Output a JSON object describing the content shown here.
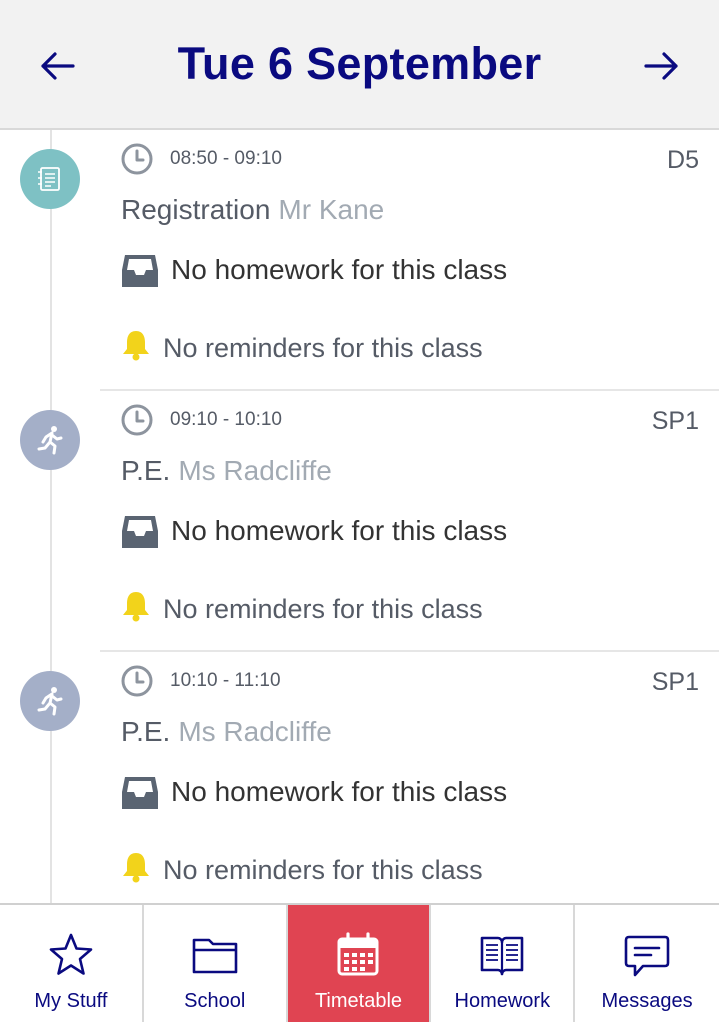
{
  "header": {
    "title": "Tue 6 September",
    "prev_icon": "arrow-left-icon",
    "next_icon": "arrow-right-icon",
    "accent_color": "#0a0a80"
  },
  "lessons": [
    {
      "time": "08:50 - 09:10",
      "room": "D5",
      "subject": "Registration",
      "teacher": "Mr Kane",
      "homework": "No homework for this class",
      "reminders": "No reminders for this class",
      "icon": "register-icon",
      "icon_color": "#7ec1c4"
    },
    {
      "time": "09:10 - 10:10",
      "room": "SP1",
      "subject": "P.E.",
      "teacher": "Ms Radcliffe",
      "homework": "No homework for this class",
      "reminders": "No reminders for this class",
      "icon": "running-person-icon",
      "icon_color": "#a4afc8"
    },
    {
      "time": "10:10 - 11:10",
      "room": "SP1",
      "subject": "P.E.",
      "teacher": "Ms Radcliffe",
      "homework": "No homework for this class",
      "reminders": "No reminders for this class",
      "icon": "running-person-icon",
      "icon_color": "#a4afc8"
    }
  ],
  "tabs": [
    {
      "label": "My Stuff",
      "icon": "star-icon",
      "active": false
    },
    {
      "label": "School",
      "icon": "folder-icon",
      "active": false
    },
    {
      "label": "Timetable",
      "icon": "calendar-icon",
      "active": true
    },
    {
      "label": "Homework",
      "icon": "book-icon",
      "active": false
    },
    {
      "label": "Messages",
      "icon": "message-icon",
      "active": false
    }
  ],
  "colors": {
    "active_tab": "#e04452",
    "reminder_bell": "#f2d31b",
    "inbox_icon": "#5a6472"
  }
}
